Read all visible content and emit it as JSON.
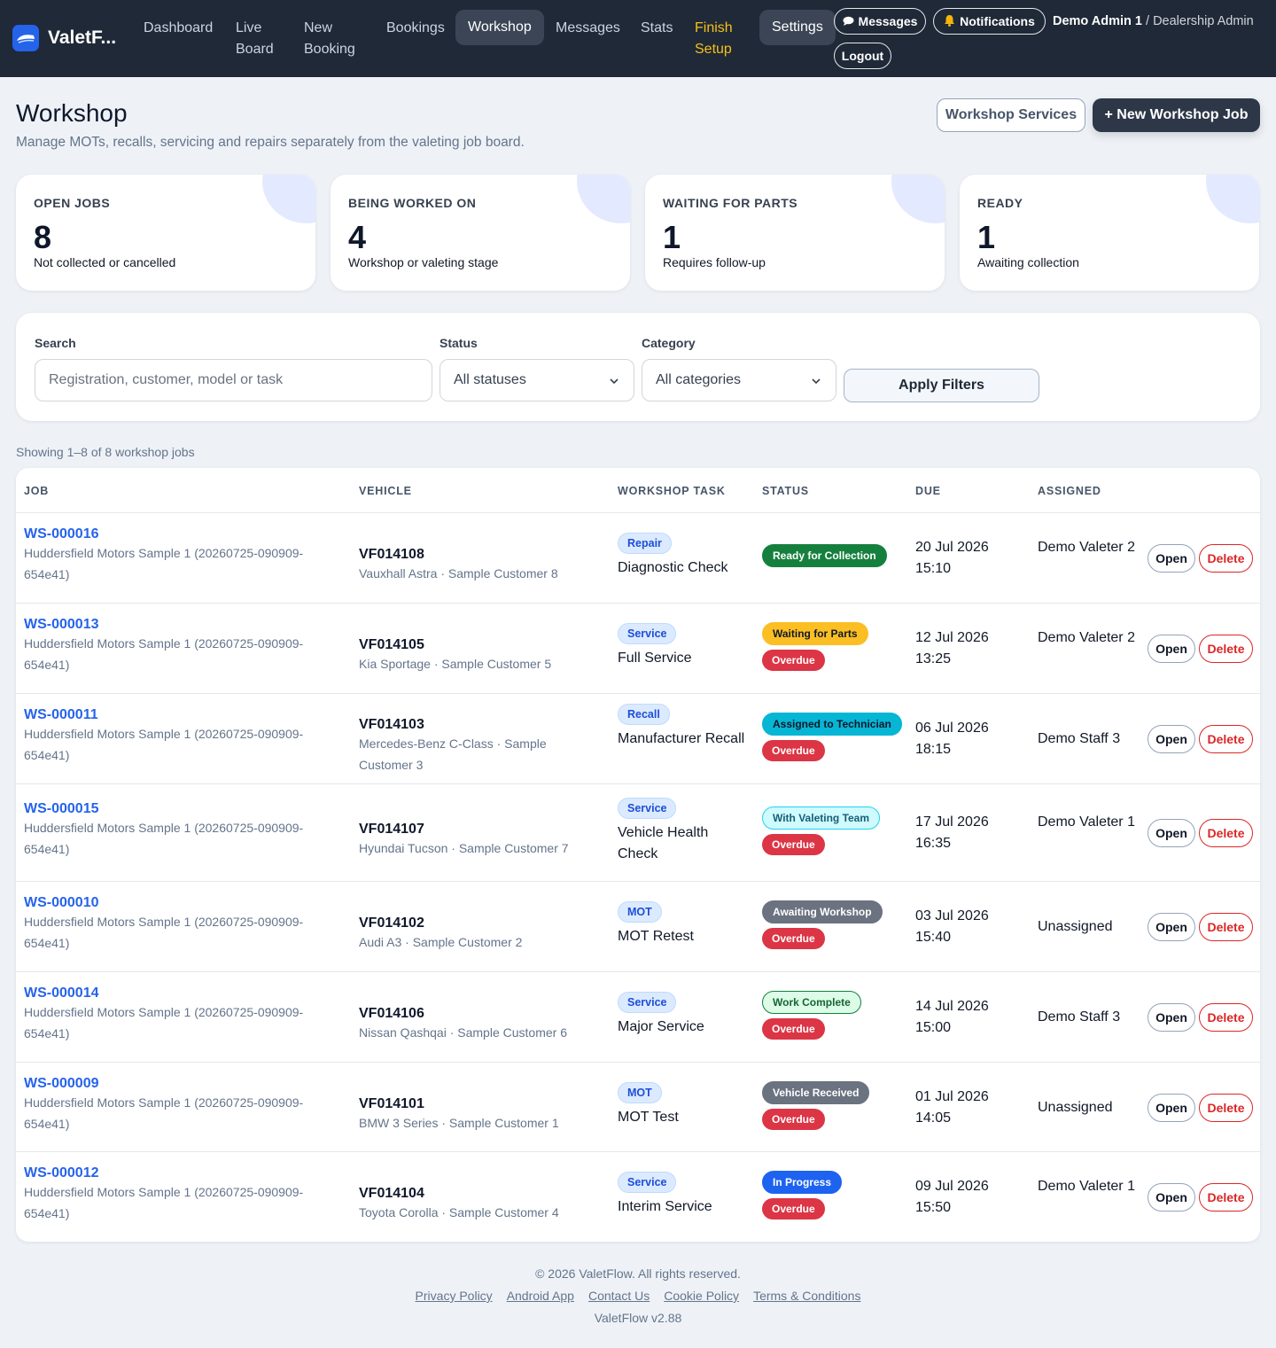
{
  "nav": {
    "brand": "ValetF...",
    "items": [
      "Dashboard",
      "Live Board",
      "New Booking",
      "Bookings",
      "Workshop",
      "Messages",
      "Stats",
      "Finish Setup",
      "Settings"
    ],
    "messages_label": "Messages",
    "notifications_label": "Notifications",
    "logout_label": "Logout",
    "user_name": "Demo Admin 1",
    "user_role": "Dealership Admin",
    "separator": " / "
  },
  "header": {
    "title": "Workshop",
    "subtitle": "Manage MOTs, recalls, servicing and repairs separately from the valeting job board.",
    "services_button": "Workshop Services",
    "new_job_button": "+ New Workshop Job"
  },
  "stats": [
    {
      "label": "OPEN JOBS",
      "value": "8",
      "desc": "Not collected or cancelled"
    },
    {
      "label": "BEING WORKED ON",
      "value": "4",
      "desc": "Workshop or valeting stage"
    },
    {
      "label": "WAITING FOR PARTS",
      "value": "1",
      "desc": "Requires follow-up"
    },
    {
      "label": "READY",
      "value": "1",
      "desc": "Awaiting collection"
    }
  ],
  "filters": {
    "search_label": "Search",
    "search_placeholder": "Registration, customer, model or task",
    "status_label": "Status",
    "status_value": "All statuses",
    "category_label": "Category",
    "category_value": "All categories",
    "apply_label": "Apply Filters"
  },
  "showing": "Showing 1–8 of 8 workshop jobs",
  "table": {
    "headers": [
      "JOB",
      "VEHICLE",
      "WORKSHOP TASK",
      "STATUS",
      "DUE",
      "ASSIGNED"
    ],
    "open_label": "Open",
    "delete_label": "Delete",
    "overdue_label": "Overdue",
    "rows": [
      {
        "id": "WS-000016",
        "dealer": "Huddersfield Motors Sample 1 (20260725-090909-654e41)",
        "reg": "VF014108",
        "vehicle": "Vauxhall Astra · Sample Customer 8",
        "category": "Repair",
        "task": "Diagnostic Check",
        "status": "Ready for Collection",
        "status_color": "#15803d",
        "status_text": "#ffffff",
        "status_border": "#15803d",
        "overdue": false,
        "due_date": "20 Jul 2026",
        "due_time": "15:10",
        "assigned": "Demo Valeter 2"
      },
      {
        "id": "WS-000013",
        "dealer": "Huddersfield Motors Sample 1 (20260725-090909-654e41)",
        "reg": "VF014105",
        "vehicle": "Kia Sportage · Sample Customer 5",
        "category": "Service",
        "task": "Full Service",
        "status": "Waiting for Parts",
        "status_color": "#fbbf24",
        "status_text": "#111827",
        "status_border": "#fbbf24",
        "overdue": true,
        "due_date": "12 Jul 2026",
        "due_time": "13:25",
        "assigned": "Demo Valeter 2"
      },
      {
        "id": "WS-000011",
        "dealer": "Huddersfield Motors Sample 1 (20260725-090909-654e41)",
        "reg": "VF014103",
        "vehicle": "Mercedes-Benz C-Class · Sample Customer 3",
        "category": "Recall",
        "task": "Manufacturer Recall",
        "status": "Assigned to Technician",
        "status_color": "#06b6d4",
        "status_text": "#0f172a",
        "status_border": "#06b6d4",
        "overdue": true,
        "due_date": "06 Jul 2026",
        "due_time": "18:15",
        "assigned": "Demo Staff 3"
      },
      {
        "id": "WS-000015",
        "dealer": "Huddersfield Motors Sample 1 (20260725-090909-654e41)",
        "reg": "VF014107",
        "vehicle": "Hyundai Tucson · Sample Customer 7",
        "category": "Service",
        "task": "Vehicle Health Check",
        "status": "With Valeting Team",
        "status_color": "#cffafe",
        "status_text": "#155e75",
        "status_border": "#22d3ee",
        "overdue": true,
        "due_date": "17 Jul 2026",
        "due_time": "16:35",
        "assigned": "Demo Valeter 1"
      },
      {
        "id": "WS-000010",
        "dealer": "Huddersfield Motors Sample 1 (20260725-090909-654e41)",
        "reg": "VF014102",
        "vehicle": "Audi A3 · Sample Customer 2",
        "category": "MOT",
        "task": "MOT Retest",
        "status": "Awaiting Workshop",
        "status_color": "#6b7280",
        "status_text": "#ffffff",
        "status_border": "#6b7280",
        "overdue": true,
        "due_date": "03 Jul 2026",
        "due_time": "15:40",
        "assigned": "Unassigned"
      },
      {
        "id": "WS-000014",
        "dealer": "Huddersfield Motors Sample 1 (20260725-090909-654e41)",
        "reg": "VF014106",
        "vehicle": "Nissan Qashqai · Sample Customer 6",
        "category": "Service",
        "task": "Major Service",
        "status": "Work Complete",
        "status_color": "#dcfce7",
        "status_text": "#166534",
        "status_border": "#15803d",
        "overdue": true,
        "due_date": "14 Jul 2026",
        "due_time": "15:00",
        "assigned": "Demo Staff 3"
      },
      {
        "id": "WS-000009",
        "dealer": "Huddersfield Motors Sample 1 (20260725-090909-654e41)",
        "reg": "VF014101",
        "vehicle": "BMW 3 Series · Sample Customer 1",
        "category": "MOT",
        "task": "MOT Test",
        "status": "Vehicle Received",
        "status_color": "#6b7280",
        "status_text": "#ffffff",
        "status_border": "#6b7280",
        "overdue": true,
        "due_date": "01 Jul 2026",
        "due_time": "14:05",
        "assigned": "Unassigned"
      },
      {
        "id": "WS-000012",
        "dealer": "Huddersfield Motors Sample 1 (20260725-090909-654e41)",
        "reg": "VF014104",
        "vehicle": "Toyota Corolla · Sample Customer 4",
        "category": "Service",
        "task": "Interim Service",
        "status": "In Progress",
        "status_color": "#1d63f0",
        "status_text": "#ffffff",
        "status_border": "#1d63f0",
        "overdue": true,
        "due_date": "09 Jul 2026",
        "due_time": "15:50",
        "assigned": "Demo Valeter 1"
      }
    ]
  },
  "footer": {
    "copyright": "© 2026 ValetFlow. All rights reserved.",
    "links": [
      "Privacy Policy",
      "Android App",
      "Contact Us",
      "Cookie Policy",
      "Terms & Conditions"
    ],
    "version": "ValetFlow v2.88"
  },
  "colors": {
    "nav_bg": "#1f2937",
    "accent": "#2563eb",
    "danger": "#dc2626",
    "overdue": "#dc3545",
    "warn": "#f5c01b"
  }
}
